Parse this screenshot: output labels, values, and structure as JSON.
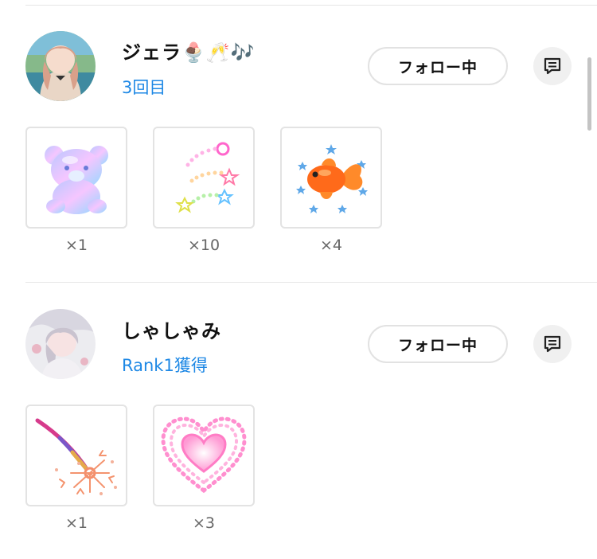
{
  "users": [
    {
      "name": "ジェラ🍨🥂🎶",
      "badge": "3回目",
      "follow_label": "フォロー中",
      "gifts": [
        {
          "icon": "bear-gift-icon",
          "count": "×1"
        },
        {
          "icon": "shooting-star-gift-icon",
          "count": "×10"
        },
        {
          "icon": "goldfish-gift-icon",
          "count": "×4"
        }
      ]
    },
    {
      "name": "しゃしゃみ",
      "badge": "Rank1獲得",
      "follow_label": "フォロー中",
      "gifts": [
        {
          "icon": "sparkler-gift-icon",
          "count": "×1"
        },
        {
          "icon": "heart-gift-icon",
          "count": "×3"
        }
      ]
    }
  ],
  "colors": {
    "badge_blue": "#1e88e5",
    "divider": "#e6e6e6"
  }
}
